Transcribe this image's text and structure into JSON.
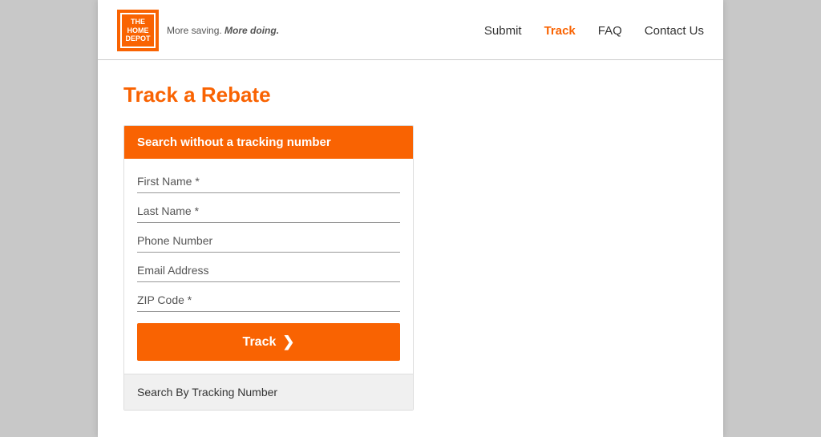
{
  "header": {
    "logo": {
      "line1": "THE",
      "line2": "HOME",
      "line3": "DEPOT",
      "tagline_pre": "More saving. ",
      "tagline_bold": "More doing."
    },
    "nav": [
      {
        "label": "Submit",
        "active": false
      },
      {
        "label": "Track",
        "active": true
      },
      {
        "label": "FAQ",
        "active": false
      },
      {
        "label": "Contact Us",
        "active": false
      }
    ]
  },
  "main": {
    "page_title": "Track a Rebate",
    "card": {
      "header": "Search without a tracking number",
      "fields": [
        {
          "placeholder": "First Name *"
        },
        {
          "placeholder": "Last Name *"
        },
        {
          "placeholder": "Phone Number"
        },
        {
          "placeholder": "Email Address"
        },
        {
          "placeholder": "ZIP Code *"
        }
      ],
      "track_button": "Track",
      "track_arrow": "❯",
      "footer": "Search By Tracking Number"
    }
  }
}
